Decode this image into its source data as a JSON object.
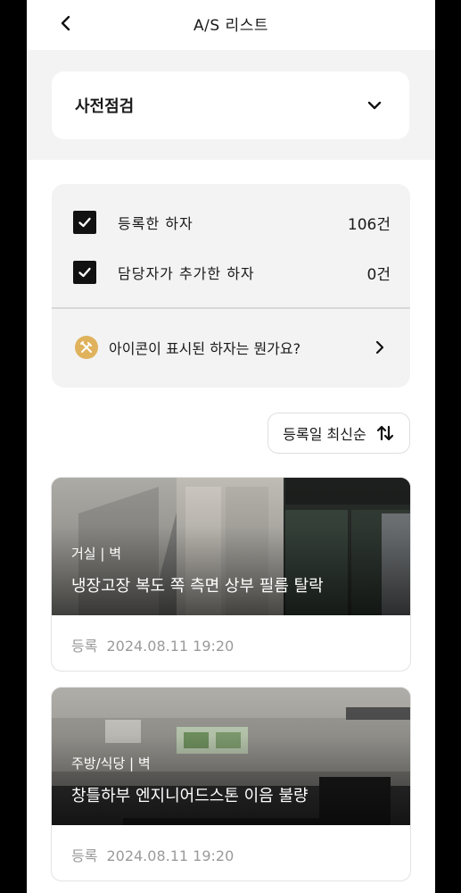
{
  "header": {
    "title": "A/S 리스트"
  },
  "dropdown": {
    "selected": "사전점검"
  },
  "filters": [
    {
      "label": "등록한 하자",
      "count": "106건",
      "checked": true
    },
    {
      "label": "담당자가 추가한 하자",
      "count": "0건",
      "checked": true
    }
  ],
  "info": {
    "text": "아이콘이 표시된 하자는 뭔가요?"
  },
  "sort": {
    "label": "등록일 최신순"
  },
  "items": [
    {
      "location": "거실 | 벽",
      "description": "냉장고장 복도 쪽 측면 상부 필름 탈락",
      "meta_label": "등록",
      "date": "2024.08.11 19:20"
    },
    {
      "location": "주방/식당 | 벽",
      "description": "창틀하부 엔지니어드스톤 이음 불량",
      "meta_label": "등록",
      "date": "2024.08.11 19:20"
    }
  ],
  "colors": {
    "icon_accent": "#e0b25c",
    "check_fill": "#111111",
    "panel_gray": "#f3f3f3",
    "meta_gray": "#9a9a9a"
  }
}
